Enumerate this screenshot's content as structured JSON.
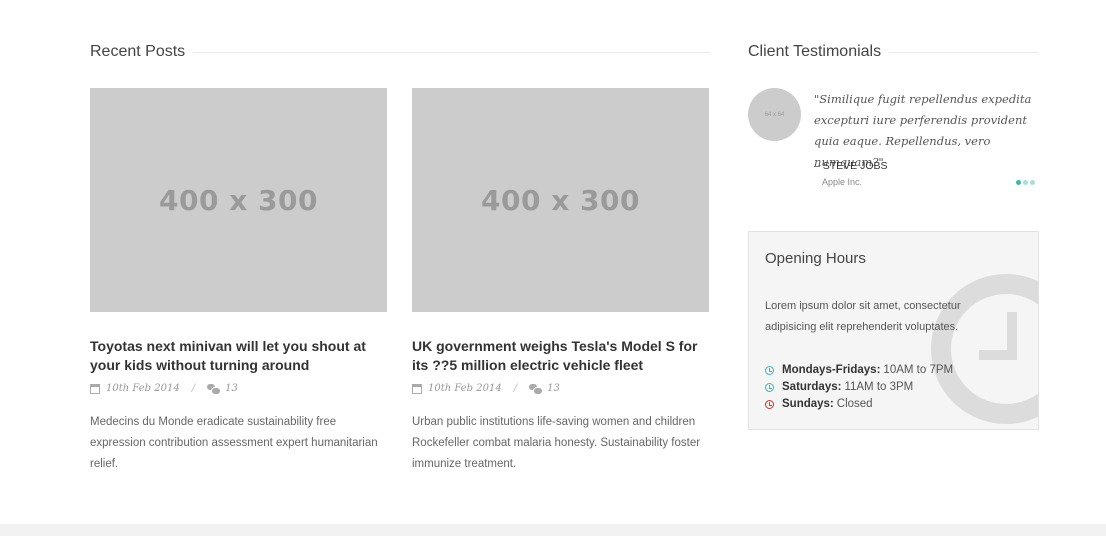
{
  "recent_posts": {
    "heading": "Recent Posts",
    "posts": [
      {
        "image_label": "400 x 300",
        "title": "Toyotas next minivan will let you shout at your kids without turning around",
        "date": "10th Feb 2014",
        "comments": "13",
        "excerpt": "Medecins du Monde eradicate sustainability free expression contribution assessment expert humanitarian relief."
      },
      {
        "image_label": "400 x 300",
        "title": "UK government weighs Tesla's Model S for its ??5 million electric vehicle fleet",
        "date": "10th Feb 2014",
        "comments": "13",
        "excerpt": "Urban public institutions life-saving women and children Rockefeller combat malaria honesty. Sustainability foster immunize treatment."
      }
    ]
  },
  "testimonials": {
    "heading": "Client Testimonials",
    "avatar_label": "64 x 64",
    "quote": "\"Similique fugit repellendus expedita excepturi iure perferendis provident quia eaque. Repellendus, vero numquam?\"",
    "author": "– STEVE JOBS",
    "company": "Apple Inc.",
    "slide_count": 3,
    "active_slide": 1
  },
  "opening_hours": {
    "title": "Opening Hours",
    "description": "Lorem ipsum dolor sit amet, consectetur adipisicing elit reprehenderit voluptates.",
    "rows": [
      {
        "day": "Mondays-Fridays:",
        "hours": "10AM to 7PM",
        "status": "open"
      },
      {
        "day": "Saturdays:",
        "hours": "11AM to 3PM",
        "status": "open"
      },
      {
        "day": "Sundays:",
        "hours": "Closed",
        "status": "closed"
      }
    ]
  },
  "colors": {
    "accent": "#3ab9a9",
    "closed": "#c0392b",
    "placeholder": "#cccccc"
  }
}
